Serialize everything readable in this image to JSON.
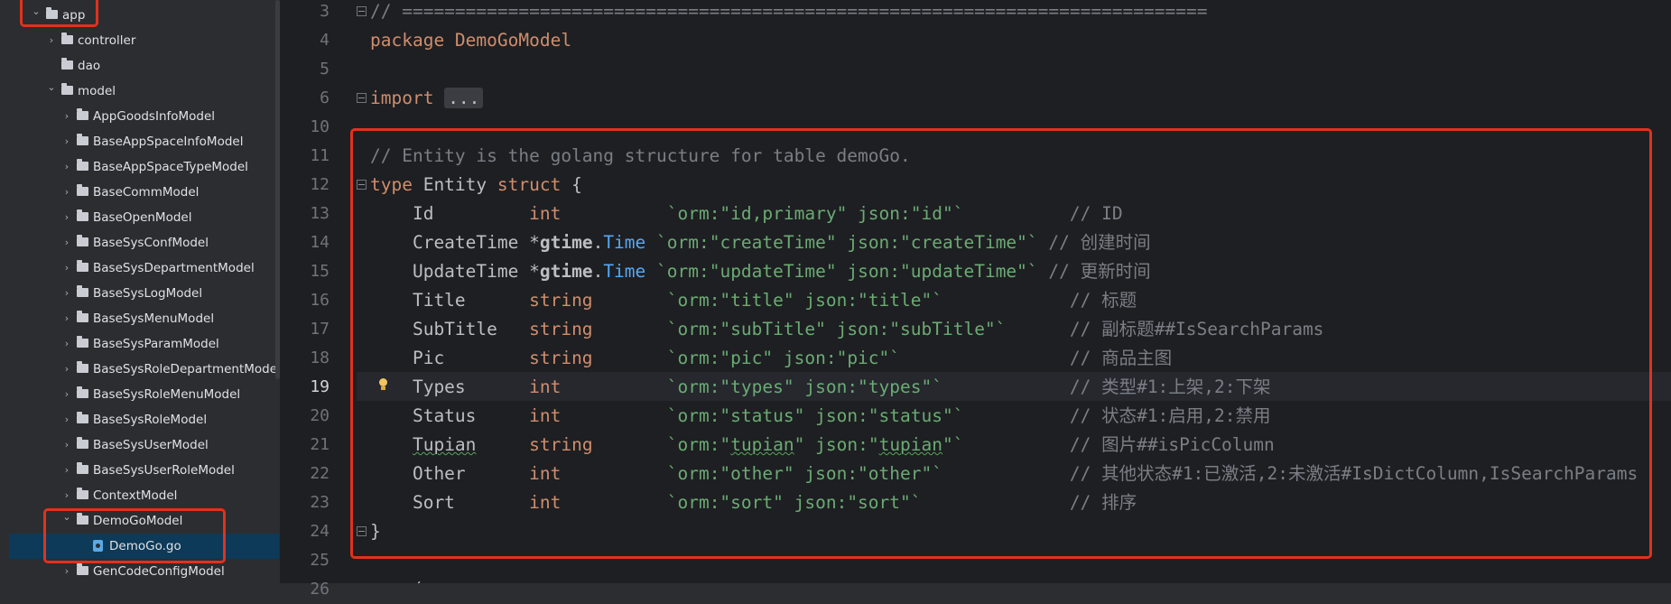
{
  "project_tree": {
    "items": [
      {
        "label": "app",
        "indent": 0,
        "kind": "folder",
        "expanded": true
      },
      {
        "label": "controller",
        "indent": 1,
        "kind": "folder",
        "expanded": false
      },
      {
        "label": "dao",
        "indent": 1,
        "kind": "folder",
        "expanded": null
      },
      {
        "label": "model",
        "indent": 1,
        "kind": "folder",
        "expanded": true
      },
      {
        "label": "AppGoodsInfoModel",
        "indent": 2,
        "kind": "folder",
        "expanded": false
      },
      {
        "label": "BaseAppSpaceInfoModel",
        "indent": 2,
        "kind": "folder",
        "expanded": false
      },
      {
        "label": "BaseAppSpaceTypeModel",
        "indent": 2,
        "kind": "folder",
        "expanded": false
      },
      {
        "label": "BaseCommModel",
        "indent": 2,
        "kind": "folder",
        "expanded": false
      },
      {
        "label": "BaseOpenModel",
        "indent": 2,
        "kind": "folder",
        "expanded": false
      },
      {
        "label": "BaseSysConfModel",
        "indent": 2,
        "kind": "folder",
        "expanded": false
      },
      {
        "label": "BaseSysDepartmentModel",
        "indent": 2,
        "kind": "folder",
        "expanded": false
      },
      {
        "label": "BaseSysLogModel",
        "indent": 2,
        "kind": "folder",
        "expanded": false
      },
      {
        "label": "BaseSysMenuModel",
        "indent": 2,
        "kind": "folder",
        "expanded": false
      },
      {
        "label": "BaseSysParamModel",
        "indent": 2,
        "kind": "folder",
        "expanded": false
      },
      {
        "label": "BaseSysRoleDepartmentModel",
        "indent": 2,
        "kind": "folder",
        "expanded": false
      },
      {
        "label": "BaseSysRoleMenuModel",
        "indent": 2,
        "kind": "folder",
        "expanded": false
      },
      {
        "label": "BaseSysRoleModel",
        "indent": 2,
        "kind": "folder",
        "expanded": false
      },
      {
        "label": "BaseSysUserModel",
        "indent": 2,
        "kind": "folder",
        "expanded": false
      },
      {
        "label": "BaseSysUserRoleModel",
        "indent": 2,
        "kind": "folder",
        "expanded": false
      },
      {
        "label": "ContextModel",
        "indent": 2,
        "kind": "folder",
        "expanded": false
      },
      {
        "label": "DemoGoModel",
        "indent": 2,
        "kind": "folder",
        "expanded": true
      },
      {
        "label": "DemoGo.go",
        "indent": 3,
        "kind": "go-file",
        "expanded": null,
        "selected": true
      },
      {
        "label": "GenCodeConfigModel",
        "indent": 2,
        "kind": "folder",
        "expanded": false
      }
    ]
  },
  "editor": {
    "current_line": "19",
    "lines": [
      {
        "n": "3",
        "tokens": [
          {
            "t": "// ============================================================================",
            "c": "comment"
          }
        ]
      },
      {
        "n": "4",
        "tokens": [
          {
            "t": "package ",
            "c": "kw"
          },
          {
            "t": "DemoGoModel",
            "c": "kw"
          }
        ]
      },
      {
        "n": "5",
        "tokens": []
      },
      {
        "n": "6",
        "tokens": [
          {
            "t": "import ",
            "c": "kw"
          },
          {
            "t": "...",
            "c": "fold"
          }
        ]
      },
      {
        "n": "10",
        "tokens": []
      },
      {
        "n": "11",
        "tokens": [
          {
            "t": "// Entity is the golang structure for table demoGo.",
            "c": "comment"
          }
        ]
      },
      {
        "n": "12",
        "tokens": [
          {
            "t": "type ",
            "c": "kw"
          },
          {
            "t": "Entity ",
            "c": "field"
          },
          {
            "t": "struct ",
            "c": "kw"
          },
          {
            "t": "{",
            "c": "field"
          }
        ]
      },
      {
        "n": "13",
        "tokens": [
          {
            "t": "    Id         ",
            "c": "field"
          },
          {
            "t": "int          ",
            "c": "type"
          },
          {
            "t": "`orm:\"id,primary\" json:\"id\"`          ",
            "c": "str"
          },
          {
            "t": "// ID",
            "c": "comment"
          }
        ]
      },
      {
        "n": "14",
        "tokens": [
          {
            "t": "    CreateTime ",
            "c": "field"
          },
          {
            "t": "*",
            "c": "field"
          },
          {
            "t": "gtime",
            "c": "bold"
          },
          {
            "t": ".",
            "c": "field"
          },
          {
            "t": "Time ",
            "c": "typename"
          },
          {
            "t": "`orm:\"createTime\" json:\"createTime\"` ",
            "c": "str"
          },
          {
            "t": "// 创建时间",
            "c": "comment"
          }
        ]
      },
      {
        "n": "15",
        "tokens": [
          {
            "t": "    UpdateTime ",
            "c": "field"
          },
          {
            "t": "*",
            "c": "field"
          },
          {
            "t": "gtime",
            "c": "bold"
          },
          {
            "t": ".",
            "c": "field"
          },
          {
            "t": "Time ",
            "c": "typename"
          },
          {
            "t": "`orm:\"updateTime\" json:\"updateTime\"` ",
            "c": "str"
          },
          {
            "t": "// 更新时间",
            "c": "comment"
          }
        ]
      },
      {
        "n": "16",
        "tokens": [
          {
            "t": "    Title      ",
            "c": "field"
          },
          {
            "t": "string       ",
            "c": "type"
          },
          {
            "t": "`orm:\"title\" json:\"title\"`            ",
            "c": "str"
          },
          {
            "t": "// 标题",
            "c": "comment"
          }
        ]
      },
      {
        "n": "17",
        "tokens": [
          {
            "t": "    SubTitle   ",
            "c": "field"
          },
          {
            "t": "string       ",
            "c": "type"
          },
          {
            "t": "`orm:\"subTitle\" json:\"subTitle\"`      ",
            "c": "str"
          },
          {
            "t": "// 副标题##IsSearchParams",
            "c": "comment"
          }
        ]
      },
      {
        "n": "18",
        "tokens": [
          {
            "t": "    Pic        ",
            "c": "field"
          },
          {
            "t": "string       ",
            "c": "type"
          },
          {
            "t": "`orm:\"pic\" json:\"pic\"`                ",
            "c": "str"
          },
          {
            "t": "// 商品主图",
            "c": "comment"
          }
        ]
      },
      {
        "n": "19",
        "tokens": [
          {
            "t": "    Types      ",
            "c": "field"
          },
          {
            "t": "int          ",
            "c": "type"
          },
          {
            "t": "`orm:\"types\" json:\"types\"`            ",
            "c": "str"
          },
          {
            "t": "// 类型#1:上架,2:下架",
            "c": "comment"
          }
        ]
      },
      {
        "n": "20",
        "tokens": [
          {
            "t": "    Status     ",
            "c": "field"
          },
          {
            "t": "int          ",
            "c": "type"
          },
          {
            "t": "`orm:\"status\" json:\"status\"`          ",
            "c": "str"
          },
          {
            "t": "// 状态#1:启用,2:禁用",
            "c": "comment"
          }
        ]
      },
      {
        "n": "21",
        "tokens": [
          {
            "t": "    ",
            "c": "field"
          },
          {
            "t": "Tupian",
            "c": "field-u"
          },
          {
            "t": "     ",
            "c": "field"
          },
          {
            "t": "string       ",
            "c": "type"
          },
          {
            "t": "`orm:\"",
            "c": "str"
          },
          {
            "t": "tupian",
            "c": "str-u"
          },
          {
            "t": "\" json:\"",
            "c": "str"
          },
          {
            "t": "tupian",
            "c": "str-u"
          },
          {
            "t": "\"`          ",
            "c": "str"
          },
          {
            "t": "// 图片##isPicColumn",
            "c": "comment"
          }
        ]
      },
      {
        "n": "22",
        "tokens": [
          {
            "t": "    Other      ",
            "c": "field"
          },
          {
            "t": "int          ",
            "c": "type"
          },
          {
            "t": "`orm:\"other\" json:\"other\"`            ",
            "c": "str"
          },
          {
            "t": "// 其他状态#1:已激活,2:未激活#IsDictColumn,IsSearchParams",
            "c": "comment"
          }
        ]
      },
      {
        "n": "23",
        "tokens": [
          {
            "t": "    Sort       ",
            "c": "field"
          },
          {
            "t": "int          ",
            "c": "type"
          },
          {
            "t": "`orm:\"sort\" json:\"sort\"`              ",
            "c": "str"
          },
          {
            "t": "// 排序",
            "c": "comment"
          }
        ]
      },
      {
        "n": "24",
        "tokens": [
          {
            "t": "}",
            "c": "field"
          }
        ]
      },
      {
        "n": "25",
        "tokens": []
      },
      {
        "n": "26",
        "tokens": [
          {
            "t": "    (",
            "c": "field"
          }
        ]
      }
    ]
  },
  "colors": {
    "annotation": "#e0321e",
    "selection": "#0d3a58",
    "keyword": "#cf8e6d",
    "string": "#6aab73",
    "comment": "#7a7e85",
    "type_name": "#56a8f5"
  }
}
